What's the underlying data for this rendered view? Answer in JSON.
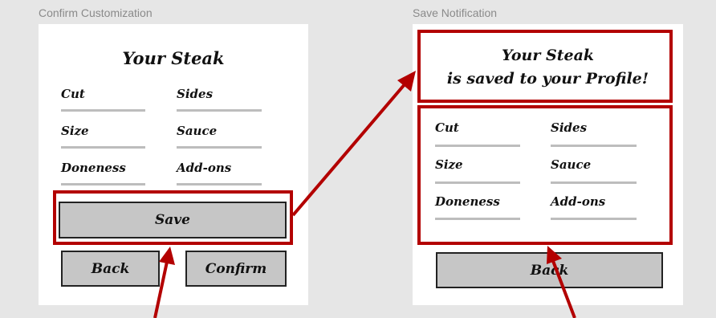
{
  "frames": {
    "confirm": {
      "label": "Confirm Customization",
      "title": "Your Steak",
      "fields": [
        "Cut",
        "Sides",
        "Size",
        "Sauce",
        "Doneness",
        "Add-ons"
      ],
      "save_label": "Save",
      "back_label": "Back",
      "confirm_label": "Confirm"
    },
    "notify": {
      "label": "Save Notification",
      "title_line1": "Your Steak",
      "title_line2": "is saved to your Profile!",
      "fields": [
        "Cut",
        "Sides",
        "Size",
        "Sauce",
        "Doneness",
        "Add-ons"
      ],
      "back_label": "Back"
    }
  },
  "colors": {
    "highlight": "#b30000",
    "button_fill": "#c6c6c6",
    "field_line": "#bdbdbd",
    "canvas": "#e6e6e6"
  }
}
